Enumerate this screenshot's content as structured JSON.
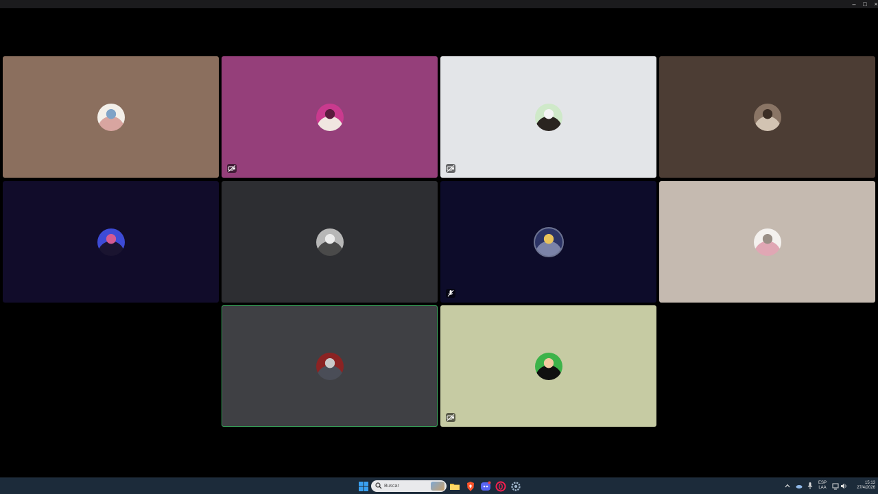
{
  "window": {
    "controls": {
      "minimize": "–",
      "maximize": "□",
      "close": "×"
    }
  },
  "participants": [
    {
      "bg": "#8b6f5e",
      "avatar": "anime-blonde-characters",
      "avatar_colors": [
        "#f3efe9",
        "#d8a5a0",
        "#7fa3c7"
      ],
      "status": "none",
      "speaking": false
    },
    {
      "bg": "#953f7a",
      "avatar": "masked-figure-pink",
      "avatar_colors": [
        "#c93a8e",
        "#f0e6e0",
        "#5a1b3e"
      ],
      "status": "camera-off",
      "speaking": false
    },
    {
      "bg": "#e3e5e8",
      "avatar": "person-dark-silhouette",
      "avatar_colors": [
        "#cfe9c9",
        "#2a2420",
        "#f4f4f4"
      ],
      "status": "camera-off",
      "speaking": false
    },
    {
      "bg": "#4c3d34",
      "avatar": "surprised-cat",
      "avatar_colors": [
        "#8a7565",
        "#d2c3b2",
        "#3c2e25"
      ],
      "status": "none",
      "speaking": false
    },
    {
      "bg": "#110c2a",
      "avatar": "blue-haired-character",
      "avatar_colors": [
        "#3d4bd6",
        "#1a1430",
        "#d35a92"
      ],
      "status": "none",
      "speaking": false
    },
    {
      "bg": "#2d2e32",
      "avatar": "grey-creature",
      "avatar_colors": [
        "#b7b7b7",
        "#4a4a4a",
        "#ececec"
      ],
      "status": "none",
      "speaking": false
    },
    {
      "bg": "#0d0c2a",
      "avatar": "black-mage",
      "avatar_colors": [
        "#2c3466",
        "#7b83a8",
        "#e8c25a"
      ],
      "status": "muted",
      "speaking": false
    },
    {
      "bg": "#c5bab0",
      "avatar": "white-cat",
      "avatar_colors": [
        "#f4f1ee",
        "#e0a7b4",
        "#9a8f86"
      ],
      "status": "none",
      "speaking": false
    },
    {
      "bg": "#3f4044",
      "avatar": "superhero-collage",
      "avatar_colors": [
        "#8b2323",
        "#4a4d57",
        "#c9c9c9"
      ],
      "status": "none",
      "speaking": true
    },
    {
      "bg": "#c6cba3",
      "avatar": "vegeta",
      "avatar_colors": [
        "#3db34a",
        "#101010",
        "#f3c9a0"
      ],
      "status": "camera-off",
      "speaking": false
    }
  ],
  "taskbar": {
    "search_placeholder": "Buscar",
    "apps": [
      "windows-start",
      "search",
      "file-explorer",
      "brave-browser",
      "discord",
      "opera-gx",
      "settings"
    ],
    "tray": {
      "lang_top": "ESP",
      "lang_bottom": "LAA",
      "time": "15:13",
      "date": "27/4/2026"
    }
  },
  "colors": {
    "speaking_outline": "#3ba55d",
    "taskbar_bg": "#1c2b3a",
    "window_bg": "#000000"
  }
}
